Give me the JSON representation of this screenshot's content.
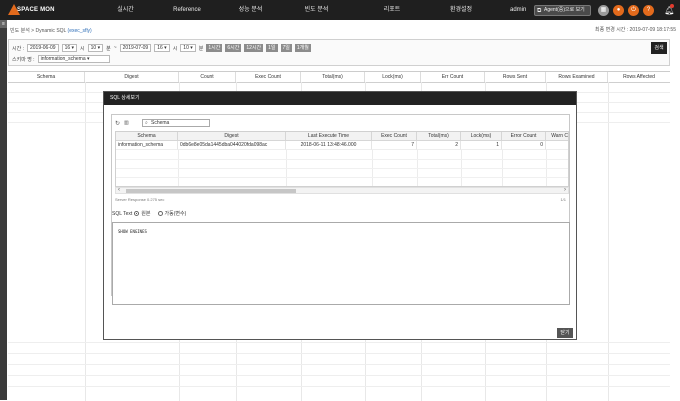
{
  "app": {
    "logo_text": "SPACE MON",
    "nav_items": [
      "실시간",
      "Reference",
      "성능 분석",
      "빈도 분석",
      "리포트",
      "환경설정"
    ],
    "user": "admin",
    "agent_button": "Agent(중)으로 보기",
    "colors": {
      "nav_bg": "#1f1f1f",
      "accent": "#e36a1c",
      "bell_badge": "#e33b2e"
    }
  },
  "breadcrumb": {
    "prefix": "빈도 분석 > Dynamic SQL ",
    "highlight": "(exec_sfly)"
  },
  "last_change": "최종 변경 시간 : 2019-07-09 18:17:55",
  "left_tab": "≡",
  "filter": {
    "time_label": "시간 :",
    "from_date": "2019-06-09",
    "from_hour": "16",
    "hour_unit": "시",
    "from_min": "10",
    "min_unit": "분",
    "tilde": "~",
    "to_date": "2019-07-09",
    "to_hour": "16",
    "to_min": "10",
    "quick_ranges": [
      "1시간",
      "6시간",
      "12시간",
      "1일",
      "7일",
      "1개월"
    ],
    "schema_label": "스키마 명 :",
    "schema_value": "information_schema",
    "search_button": "검색"
  },
  "background_table": {
    "columns": [
      "Schema",
      "Digest",
      "Count",
      "Exec Count",
      "Total(ms)",
      "Lock(ms)",
      "Err Count",
      "Rows Sent",
      "Rows Examined",
      "Rows Affected"
    ]
  },
  "modal": {
    "title": "SQL 상세보기",
    "schema_search": "Schema",
    "columns": [
      "Schema",
      "Digest",
      "Last Execute Time",
      "Exec Count",
      "Total(ms)",
      "Lock(ms)",
      "Error Count",
      "Warn Co"
    ],
    "row": {
      "schema": "information_schema",
      "digest": "0db6e8e05da1445dba044020fda098ac",
      "last_execute_time": "2018-06-11 13:48:46.000",
      "exec_count": "7",
      "total_ms": "2",
      "lock_ms": "1",
      "error_count": "0",
      "warn_count": ""
    },
    "server_response": "Server Response 0.275 sec",
    "page_count": "1/1",
    "sql_text_label": "SQL Text",
    "option_original": "원본",
    "option_variable": "가동(변수)",
    "sql_text": "SHOW ENGINES",
    "close_button": "닫기"
  },
  "icons": {
    "refresh": "refresh-icon",
    "columns": "columns-icon",
    "search": "search-icon",
    "scroll_left": "chevron-left-icon",
    "scroll_right": "chevron-right-icon"
  }
}
